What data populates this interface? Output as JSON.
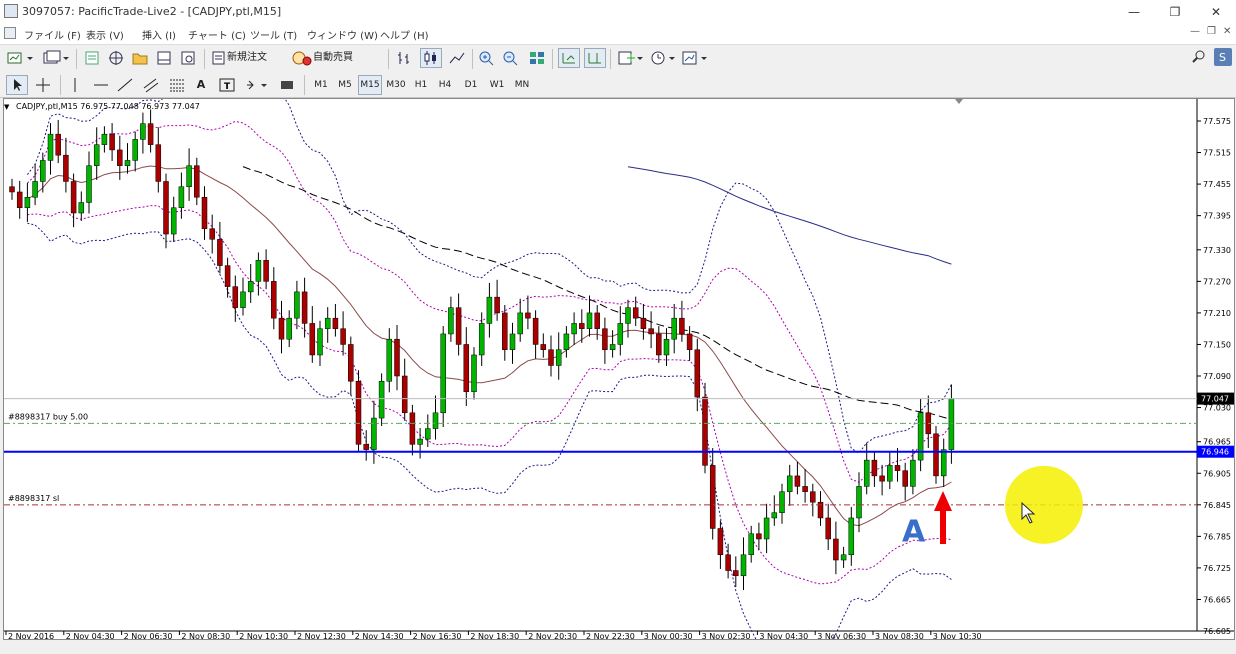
{
  "window": {
    "title": "3097057: PacificTrade-Live2 - [CADJPY,ptl,M15]",
    "min": "—",
    "max": "❐",
    "close": "✕"
  },
  "menu": {
    "items": [
      "ファイル (F)",
      "表示 (V)",
      "挿入 (I)",
      "チャート (C)",
      "ツール (T)",
      "ウィンドウ (W)",
      "ヘルプ (H)"
    ],
    "mdi": {
      "min": "—",
      "restore": "❐",
      "close": "✕"
    }
  },
  "toolbar": {
    "new_order": "新規注文",
    "auto_trade": "自動売買"
  },
  "timeframes": [
    "M1",
    "M5",
    "M15",
    "M30",
    "H1",
    "H4",
    "D1",
    "W1",
    "MN"
  ],
  "active_timeframe": "M15",
  "chart_data": {
    "type": "candlestick",
    "symbol_header": "CADJPY,ptl,M15  76.975 77.048 76.973 77.047",
    "y_ticks": [
      77.575,
      77.515,
      77.455,
      77.395,
      77.33,
      77.27,
      77.21,
      77.15,
      77.09,
      77.03,
      76.965,
      76.905,
      76.845,
      76.785,
      76.725,
      76.665,
      76.605
    ],
    "x_labels": [
      "2 Nov 2016",
      "2 Nov 04:30",
      "2 Nov 06:30",
      "2 Nov 08:30",
      "2 Nov 10:30",
      "2 Nov 12:30",
      "2 Nov 14:30",
      "2 Nov 16:30",
      "2 Nov 18:30",
      "2 Nov 20:30",
      "2 Nov 22:30",
      "3 Nov 00:30",
      "3 Nov 02:30",
      "3 Nov 04:30",
      "3 Nov 06:30",
      "3 Nov 08:30",
      "3 Nov 10:30"
    ],
    "current_price": "77.047",
    "order_line": {
      "label": "#8898317 buy 5.00",
      "price": 77.0
    },
    "sl_line": {
      "label": "#8898317 sl",
      "price": 76.845
    },
    "hline": {
      "price": "76.946",
      "color": "#0000ff"
    },
    "closes": [
      77.44,
      77.41,
      77.43,
      77.46,
      77.5,
      77.55,
      77.51,
      77.46,
      77.4,
      77.42,
      77.49,
      77.53,
      77.55,
      77.52,
      77.49,
      77.5,
      77.54,
      77.57,
      77.53,
      77.46,
      77.36,
      77.41,
      77.45,
      77.49,
      77.43,
      77.37,
      77.35,
      77.3,
      77.26,
      77.22,
      77.25,
      77.27,
      77.31,
      77.27,
      77.2,
      77.16,
      77.2,
      77.25,
      77.19,
      77.13,
      77.18,
      77.2,
      77.18,
      77.15,
      77.08,
      76.96,
      76.95,
      77.01,
      77.08,
      77.16,
      77.09,
      77.02,
      76.96,
      76.97,
      76.99,
      77.02,
      77.17,
      77.22,
      77.15,
      77.06,
      77.13,
      77.19,
      77.24,
      77.21,
      77.14,
      77.17,
      77.21,
      77.2,
      77.15,
      77.14,
      77.11,
      77.14,
      77.17,
      77.19,
      77.18,
      77.21,
      77.18,
      77.14,
      77.15,
      77.19,
      77.22,
      77.2,
      77.18,
      77.17,
      77.13,
      77.16,
      77.2,
      77.17,
      77.14,
      77.05,
      76.92,
      76.8,
      76.75,
      76.72,
      76.71,
      76.75,
      76.79,
      76.78,
      76.82,
      76.83,
      76.87,
      76.9,
      76.88,
      76.87,
      76.85,
      76.82,
      76.78,
      76.74,
      76.75,
      76.82,
      76.88,
      76.93,
      76.9,
      76.89,
      76.92,
      76.91,
      76.88,
      76.93,
      77.02,
      76.98,
      76.9,
      76.95,
      77.047
    ],
    "series": [
      {
        "color": "#000000",
        "style": "dashed"
      },
      {
        "color": "#2b2b8a",
        "style": "solid"
      },
      {
        "color": "#1a1a8c",
        "style": "dotted"
      },
      {
        "color": "#b000b0",
        "style": "dotted"
      },
      {
        "color": "#8b4a4a",
        "style": "solid"
      }
    ],
    "colors": {
      "bull": "#00b400",
      "bear": "#aa0000",
      "wick": "#000000"
    }
  },
  "annotations": {
    "marker_letter": "A",
    "marker_color": "#3a6fc9",
    "arrow_color": "#ee0000",
    "highlight_color": "#f5f000"
  }
}
